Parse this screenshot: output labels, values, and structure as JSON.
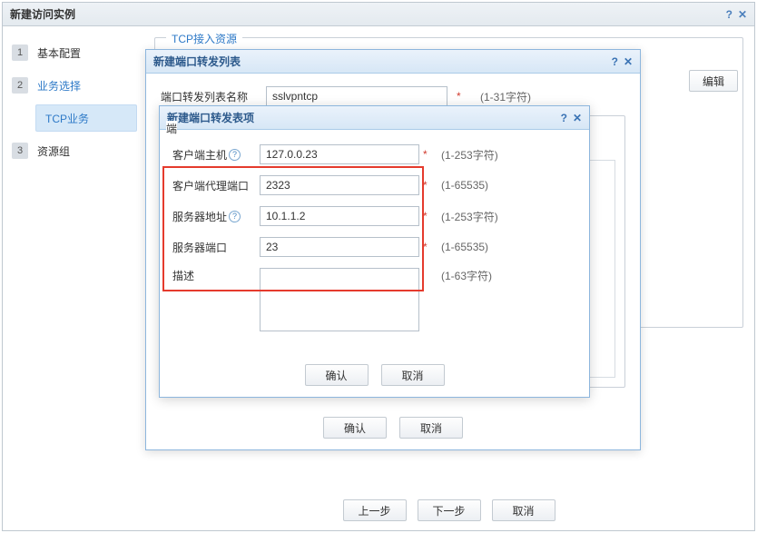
{
  "outer": {
    "title": "新建访问实例",
    "prev": "上一步",
    "next": "下一步",
    "cancel": "取消"
  },
  "steps": {
    "s1": "基本配置",
    "s2": "业务选择",
    "sub": "TCP业务",
    "s3": "资源组",
    "n1": "1",
    "n2": "2",
    "n3": "3"
  },
  "fieldset": {
    "legend": "TCP接入资源"
  },
  "edit_btn": "编辑",
  "modal1": {
    "title": "新建端口转发列表",
    "name_label": "端口转发列表名称",
    "name_value": "sslvpntcp",
    "name_hint": "(1-31字符)",
    "sub_legend": "端",
    "ok": "确认",
    "cancel": "取消",
    "star": "*"
  },
  "modal2": {
    "title": "新建端口转发表项",
    "f1_label": "客户端主机",
    "f1_value": "127.0.0.23",
    "f1_hint": "(1-253字符)",
    "f2_label": "客户端代理端口",
    "f2_value": "2323",
    "f2_hint": "(1-65535)",
    "f3_label": "服务器地址",
    "f3_value": "10.1.1.2",
    "f3_hint": "(1-253字符)",
    "f4_label": "服务器端口",
    "f4_value": "23",
    "f4_hint": "(1-65535)",
    "f5_label": "描述",
    "f5_value": "",
    "f5_hint": "(1-63字符)",
    "ok": "确认",
    "cancel": "取消",
    "star": "*",
    "help": "?"
  },
  "icons": {
    "help": "?",
    "close": "✕",
    "plus": "+"
  }
}
